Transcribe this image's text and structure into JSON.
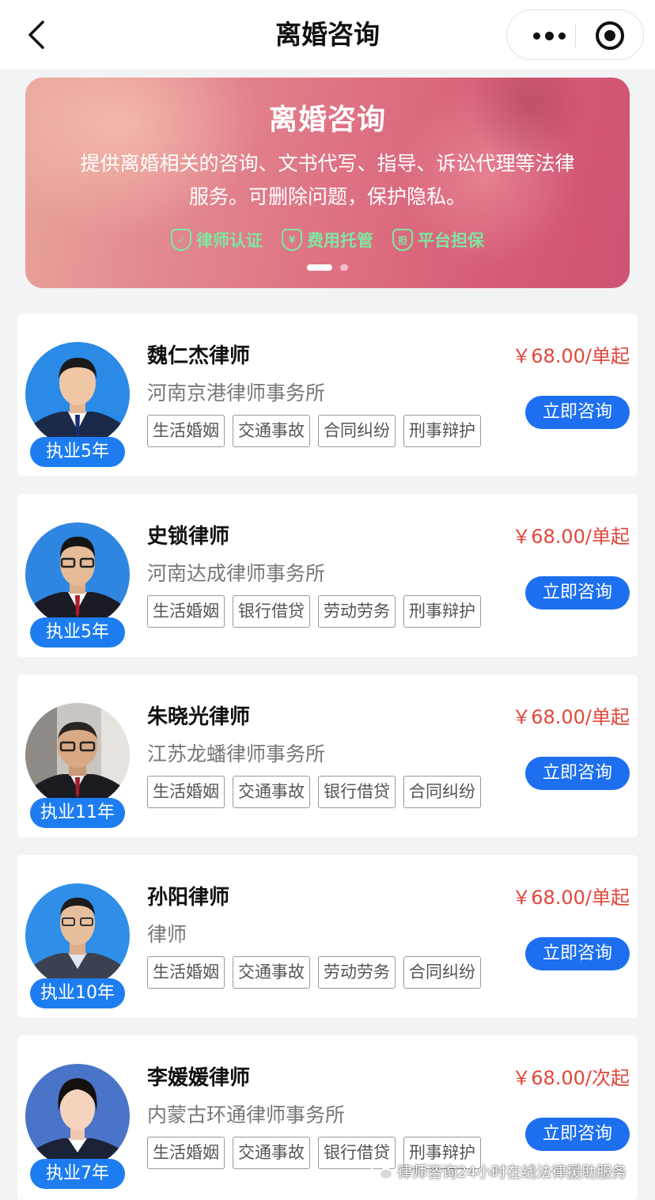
{
  "nav": {
    "title": "离婚咨询"
  },
  "banner": {
    "title": "离婚咨询",
    "description": "提供离婚相关的咨询、文书代写、指导、诉讼代理等法律服务。可删除问题，保护隐私。",
    "badges": [
      {
        "label": "律师认证",
        "icon": "shield-check-icon",
        "glyph": "✓"
      },
      {
        "label": "费用托管",
        "icon": "user-shield-icon",
        "glyph": "¥"
      },
      {
        "label": "平台担保",
        "icon": "guarantee-shield-icon",
        "glyph": "担"
      }
    ],
    "active_slide": 1,
    "slide_count": 2
  },
  "lawyers": [
    {
      "name": "魏仁杰律师",
      "firm": "河南京港律师事务所",
      "experience": "执业5年",
      "price": "￥68.00/单起",
      "tags": [
        "生活婚姻",
        "交通事故",
        "合同纠纷",
        "刑事辩护"
      ],
      "button": "立即咨询"
    },
    {
      "name": "史锁律师",
      "firm": "河南达成律师事务所",
      "experience": "执业5年",
      "price": "￥68.00/单起",
      "tags": [
        "生活婚姻",
        "银行借贷",
        "劳动劳务",
        "刑事辩护"
      ],
      "button": "立即咨询"
    },
    {
      "name": "朱晓光律师",
      "firm": "江苏龙蟠律师事务所",
      "experience": "执业11年",
      "price": "￥68.00/单起",
      "tags": [
        "生活婚姻",
        "交通事故",
        "银行借贷",
        "合同纠纷"
      ],
      "button": "立即咨询"
    },
    {
      "name": "孙阳律师",
      "firm": "律师",
      "experience": "执业10年",
      "price": "￥68.00/单起",
      "tags": [
        "生活婚姻",
        "交通事故",
        "劳动劳务",
        "合同纠纷"
      ],
      "button": "立即咨询"
    },
    {
      "name": "李媛媛律师",
      "firm": "内蒙古环通律师事务所",
      "experience": "执业7年",
      "price": "￥68.00/次起",
      "tags": [
        "生活婚姻",
        "交通事故",
        "银行借贷",
        "刑事辩护"
      ],
      "button": "立即咨询"
    }
  ],
  "watermark": {
    "text": "律师咨询24小时在线法律援助服务"
  },
  "colors": {
    "accent_blue": "#1d6ff0",
    "badge_blue": "#1d7df0",
    "price_red": "#e2463b",
    "badge_green": "#7fe7a0"
  }
}
